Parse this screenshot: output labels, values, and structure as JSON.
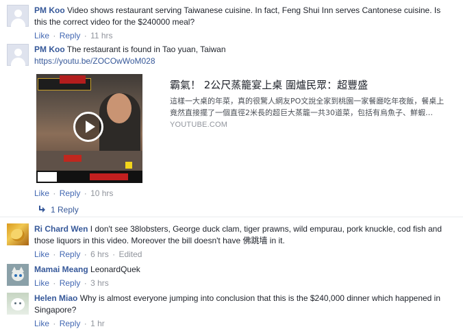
{
  "comments": [
    {
      "name": "PM Koo",
      "text": "Video shows restaurant serving Taiwanese cuisine. In fact, Feng Shui Inn serves Cantonese cuisine. Is this the correct video for the $240000 meal?",
      "like": "Like",
      "reply": "Reply",
      "time": "11 hrs",
      "avatar": "default-avatar-icon"
    },
    {
      "name": "PM Koo",
      "text": "The restaurant is found in Tao yuan, Taiwan",
      "link": "https://youtu.be/ZOCOwWoM028",
      "like": "Like",
      "reply": "Reply",
      "time": "10 hrs",
      "avatar": "default-avatar-icon",
      "preview": {
        "title": "霸氣！ 2公尺蒸籠宴上桌 圍爐民眾：超豐盛",
        "description": "這樣一大桌的年菜，真的很驚人網友PO文說全家到桃園一家餐廳吃年夜飯，餐桌上竟然直接擺了一個直徑2米長的超巨大蒸籠一共30道菜，包括有烏魚子、鮮蝦…",
        "domain": "YOUTUBE.COM"
      },
      "replies_label": "1 Reply"
    },
    {
      "name": "Ri Chard Wen",
      "text": "I don't see 38lobsters, George duck clam, tiger prawns, wild empurau, pork knuckle, cod fish and those liquors in this video. Moreover the bill doesn't have 佛跳墙 in it.",
      "like": "Like",
      "reply": "Reply",
      "time": "6 hrs",
      "edited": "Edited",
      "avatar": "gold-avatar-icon"
    },
    {
      "name": "Mamai Meang",
      "text": "LeonardQuek",
      "like": "Like",
      "reply": "Reply",
      "time": "3 hrs",
      "avatar": "cat-avatar-icon"
    },
    {
      "name": "Helen Miao",
      "text": "Why is almost everyone jumping into conclusion that this is the $240,000 dinner which happened in Singapore?",
      "like": "Like",
      "reply": "Reply",
      "time": "1 hr",
      "avatar": "snow-avatar-icon"
    }
  ],
  "separator": "·",
  "colors": {
    "name_link": "#365899",
    "action_link": "#4267b2",
    "meta": "#90949c",
    "text": "#1d2129"
  }
}
